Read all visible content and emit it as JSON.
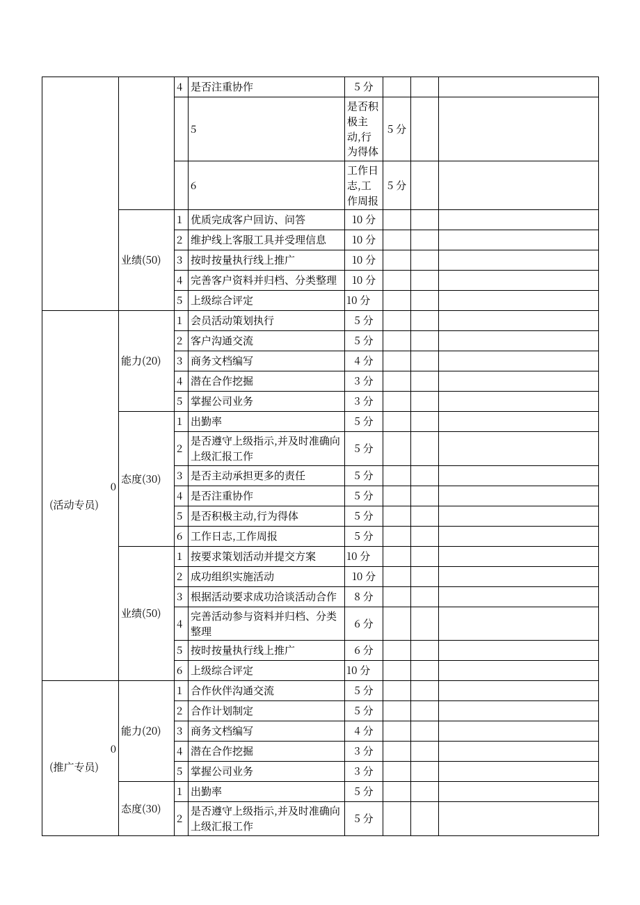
{
  "rows": [
    {
      "a": "",
      "b": "",
      "c": "4",
      "d": "是否注重协作",
      "e": "5 分",
      "ec": true
    },
    {
      "a": "",
      "b": "",
      "c": "5",
      "d": "是否积极主动,行为得体",
      "e": "5 分",
      "ec": true
    },
    {
      "a": "",
      "b": "",
      "c": "6",
      "d": "工作日志,工作周报",
      "e": "5 分",
      "ec": true
    },
    {
      "a": "",
      "b": "业绩(50)",
      "bspan": 5,
      "c": "1",
      "d": "优质完成客户回访、问答",
      "e": "10 分",
      "ec": true
    },
    {
      "c": "2",
      "d": "维护线上客服工具并受理信息",
      "e": "10 分",
      "ec": true
    },
    {
      "c": "3",
      "d": "按时按量执行线上推广",
      "e": "10 分",
      "ec": true
    },
    {
      "c": "4",
      "d": "完善客户资料并归档、分类整理",
      "e": "10 分",
      "ec": true
    },
    {
      "c": "5",
      "d": "上级综合评定",
      "e": "10 分",
      "ec": false
    },
    {
      "a": {
        "zero": "0",
        "txt": "(活动专员)"
      },
      "aspan": 17,
      "b": "能力(20)",
      "bspan": 5,
      "c": "1",
      "d": "会员活动策划执行",
      "e": "5 分",
      "ec": true
    },
    {
      "c": "2",
      "d": "客户沟通交流",
      "e": "5 分",
      "ec": true
    },
    {
      "c": "3",
      "d": "商务文档编写",
      "e": "4 分",
      "ec": true
    },
    {
      "c": "4",
      "d": "潜在合作挖掘",
      "e": "3 分",
      "ec": true
    },
    {
      "c": "5",
      "d": "掌握公司业务",
      "e": "3 分",
      "ec": true
    },
    {
      "b": "态度(30)",
      "bspan": 6,
      "c": "1",
      "d": "出勤率",
      "e": "5 分",
      "ec": true
    },
    {
      "c": "2",
      "d": "是否遵守上级指示,并及时准确向上级汇报工作",
      "e": "5 分",
      "ec": true
    },
    {
      "c": "3",
      "d": "是否主动承担更多的责任",
      "e": "5 分",
      "ec": true
    },
    {
      "c": "4",
      "d": "是否注重协作",
      "e": "5 分",
      "ec": true
    },
    {
      "c": "5",
      "d": "是否积极主动,行为得体",
      "e": "5 分",
      "ec": true
    },
    {
      "c": "6",
      "d": "工作日志,工作周报",
      "e": "5 分",
      "ec": true
    },
    {
      "b": "业绩(50)",
      "bspan": 6,
      "c": "1",
      "d": "按要求策划活动并提交方案",
      "e": "10 分",
      "ec": false
    },
    {
      "c": "2",
      "d": "成功组织实施活动",
      "e": "10 分",
      "ec": true
    },
    {
      "c": "3",
      "d": "根据活动要求成功洽谈活动合作",
      "e": "8 分",
      "ec": true
    },
    {
      "c": "4",
      "d": "完善活动参与资料并归档、分类整理",
      "e": "6 分",
      "ec": true
    },
    {
      "c": "5",
      "d": "按时按量执行线上推广",
      "e": "6 分",
      "ec": true
    },
    {
      "c": "6",
      "d": "上级综合评定",
      "e": "10 分",
      "ec": false
    },
    {
      "a": {
        "zero": "0",
        "txt": "(推广专员)"
      },
      "aspan": 7,
      "b": "能力(20)",
      "bspan": 5,
      "c": "1",
      "d": "合作伙伴沟通交流",
      "e": "5 分",
      "ec": true
    },
    {
      "c": "2",
      "d": "合作计划制定",
      "e": "5 分",
      "ec": true
    },
    {
      "c": "3",
      "d": "商务文档编写",
      "e": "4 分",
      "ec": true
    },
    {
      "c": "4",
      "d": "潜在合作挖掘",
      "e": "3 分",
      "ec": true
    },
    {
      "c": "5",
      "d": "掌握公司业务",
      "e": "3 分",
      "ec": true
    },
    {
      "b": "态度(30)",
      "bspan": 2,
      "c": "1",
      "d": "出勤率",
      "e": "5 分",
      "ec": true
    },
    {
      "c": "2",
      "d": "是否遵守上级指示,并及时准确向上级汇报工作",
      "e": "5 分",
      "ec": true
    }
  ]
}
